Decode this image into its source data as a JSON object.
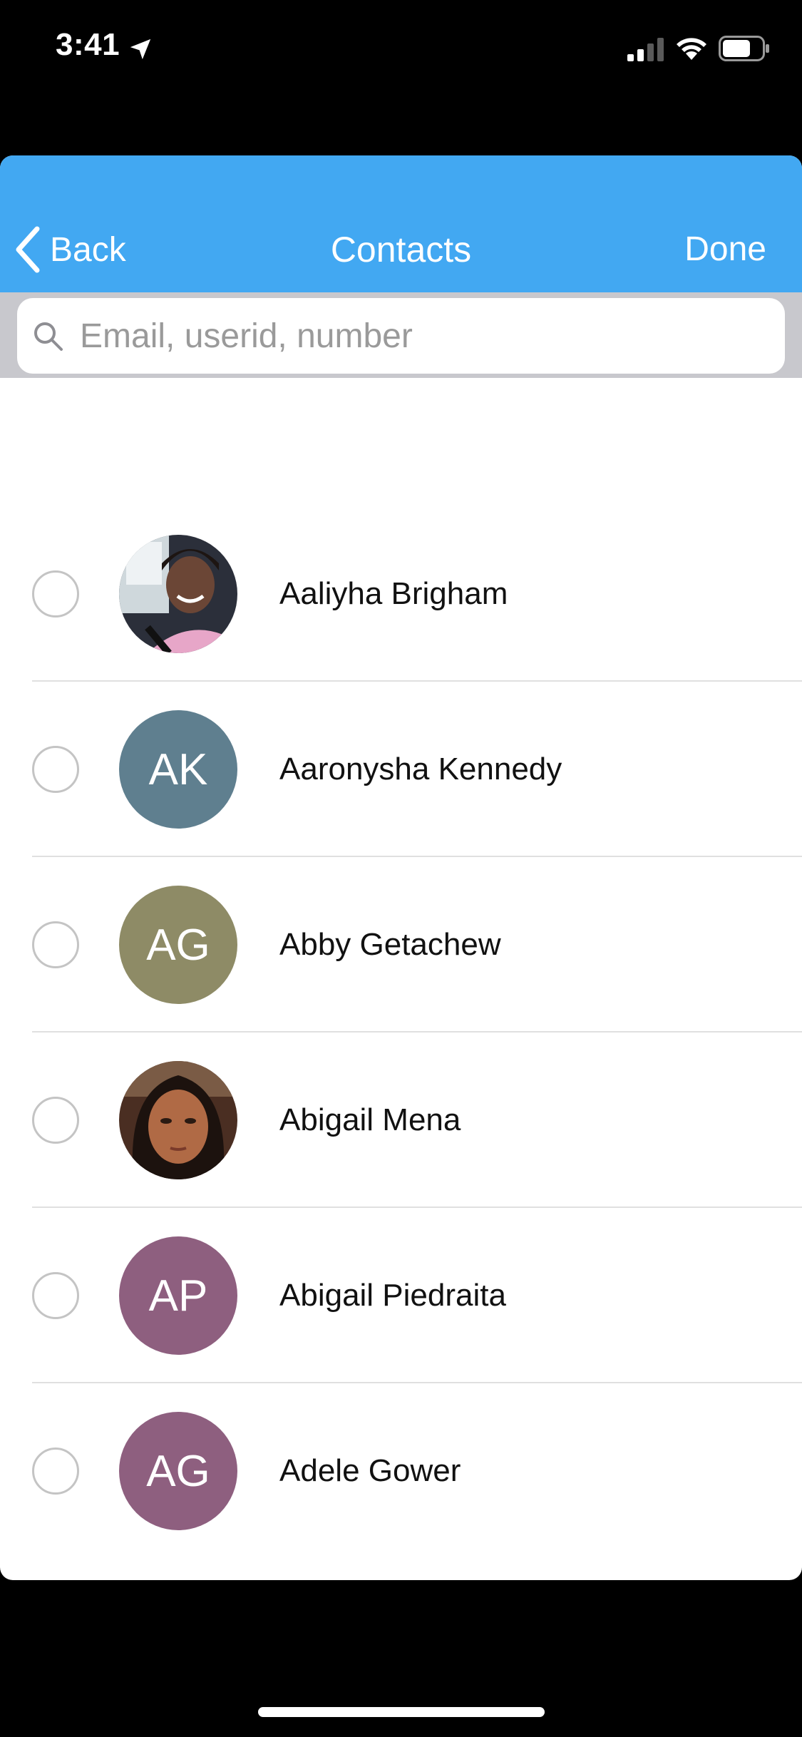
{
  "status_bar": {
    "time": "3:41",
    "icons": [
      "location-arrow-icon",
      "signal-icon",
      "wifi-icon",
      "battery-icon"
    ]
  },
  "nav": {
    "back_label": "Back",
    "title": "Contacts",
    "done_label": "Done",
    "accent_color": "#42a8f2"
  },
  "search": {
    "placeholder": "Email, userid, number",
    "value": ""
  },
  "contacts": [
    {
      "name": "Aaliyha Brigham",
      "avatar_type": "photo",
      "initials": "",
      "avatar_color": "#2b2f3a",
      "selected": false
    },
    {
      "name": "Aaronysha Kennedy",
      "avatar_type": "initials",
      "initials": "AK",
      "avatar_color": "#5f7f8f",
      "selected": false
    },
    {
      "name": "Abby Getachew",
      "avatar_type": "initials",
      "initials": "AG",
      "avatar_color": "#8e8b66",
      "selected": false
    },
    {
      "name": "Abigail Mena",
      "avatar_type": "photo",
      "initials": "",
      "avatar_color": "#5a3a2a",
      "selected": false
    },
    {
      "name": "Abigail Piedraita",
      "avatar_type": "initials",
      "initials": "AP",
      "avatar_color": "#8e5f7f",
      "selected": false
    },
    {
      "name": "Adele Gower",
      "avatar_type": "initials",
      "initials": "AG",
      "avatar_color": "#8e5f7f",
      "selected": false
    }
  ]
}
